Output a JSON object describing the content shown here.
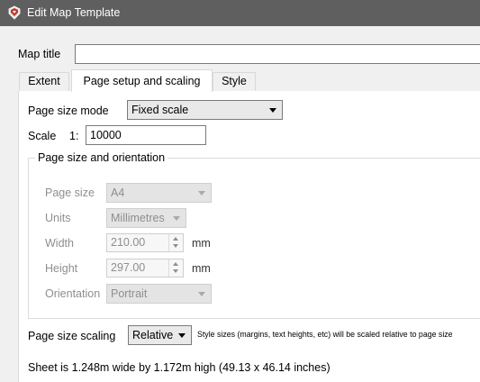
{
  "window": {
    "title": "Edit Map Template",
    "icon": "map-template-app-icon"
  },
  "map_title": {
    "label": "Map title",
    "value": ""
  },
  "tabs": [
    {
      "label": "Extent",
      "active": false
    },
    {
      "label": "Page setup and scaling",
      "active": true
    },
    {
      "label": "Style",
      "active": false
    }
  ],
  "page_size_mode": {
    "label": "Page size mode",
    "value": "Fixed scale"
  },
  "scale": {
    "label": "Scale",
    "prefix": "1:",
    "value": "10000"
  },
  "group": {
    "title": "Page size and orientation",
    "page_size": {
      "label": "Page size",
      "value": "A4"
    },
    "units": {
      "label": "Units",
      "value": "Millimetres"
    },
    "width": {
      "label": "Width",
      "value": "210.00",
      "unit": "mm"
    },
    "height": {
      "label": "Height",
      "value": "297.00",
      "unit": "mm"
    },
    "orientation": {
      "label": "Orientation",
      "value": "Portrait"
    }
  },
  "page_size_scaling": {
    "label": "Page size scaling",
    "value": "Relative",
    "hint": "Style sizes (margins, text heights, etc) will be scaled relative to page size"
  },
  "sheet_info": "Sheet is 1.248m wide by 1.172m high (49.13 x 46.14 inches)",
  "colors": {
    "titlebar": "#5f5f5f",
    "panel": "#ffffff",
    "dialog": "#f0f0f0"
  }
}
